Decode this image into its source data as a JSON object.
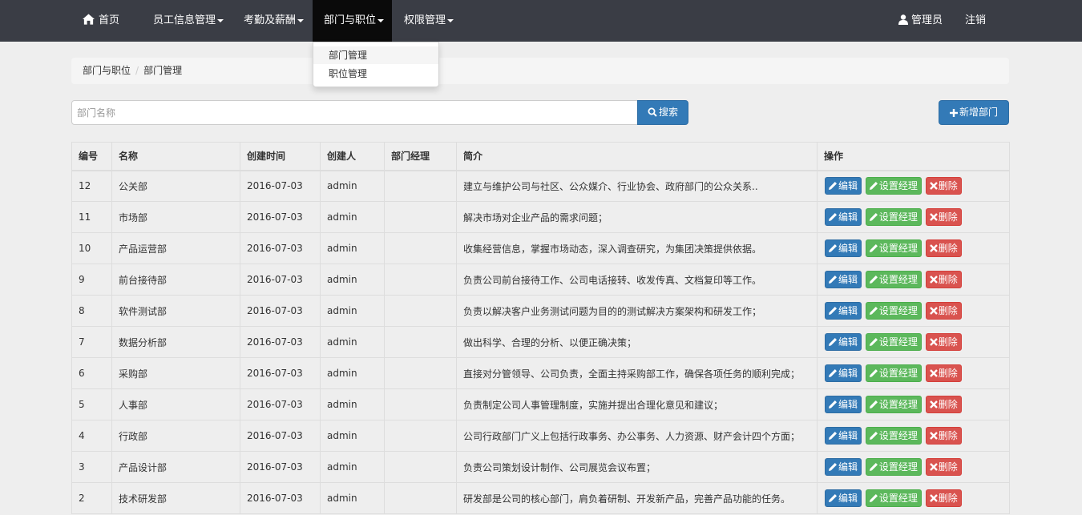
{
  "navbar": {
    "home": "首页",
    "menus": [
      "员工信息管理",
      "考勤及薪酬",
      "部门与职位",
      "权限管理"
    ],
    "user": "管理员",
    "logout": "注销"
  },
  "dropdown": {
    "items": [
      "部门管理",
      "职位管理"
    ]
  },
  "breadcrumb": {
    "parent": "部门与职位",
    "current": "部门管理"
  },
  "search": {
    "placeholder": "部门名称",
    "button": "搜索"
  },
  "add_button": "新增部门",
  "table": {
    "headers": [
      "编号",
      "名称",
      "创建时间",
      "创建人",
      "部门经理",
      "简介",
      "操作"
    ],
    "actions": {
      "edit": "编辑",
      "set_manager": "设置经理",
      "delete": "删除"
    },
    "rows": [
      {
        "id": "12",
        "name": "公关部",
        "created": "2016-07-03",
        "creator": "admin",
        "manager": "",
        "desc": "建立与维护公司与社区、公众媒介、行业协会、政府部门的公众关系.."
      },
      {
        "id": "11",
        "name": "市场部",
        "created": "2016-07-03",
        "creator": "admin",
        "manager": "",
        "desc": "解决市场对企业产品的需求问题；"
      },
      {
        "id": "10",
        "name": "产品运营部",
        "created": "2016-07-03",
        "creator": "admin",
        "manager": "",
        "desc": "收集经营信息，掌握市场动态，深入调查研究，为集团决策提供依据。"
      },
      {
        "id": "9",
        "name": "前台接待部",
        "created": "2016-07-03",
        "creator": "admin",
        "manager": "",
        "desc": "负责公司前台接待工作、公司电话接转、收发传真、文档复印等工作。"
      },
      {
        "id": "8",
        "name": "软件测试部",
        "created": "2016-07-03",
        "creator": "admin",
        "manager": "",
        "desc": "负责以解决客户业务测试问题为目的的测试解决方案架构和研发工作；"
      },
      {
        "id": "7",
        "name": "数据分析部",
        "created": "2016-07-03",
        "creator": "admin",
        "manager": "",
        "desc": "做出科学、合理的分析、以便正确决策；"
      },
      {
        "id": "6",
        "name": "采购部",
        "created": "2016-07-03",
        "creator": "admin",
        "manager": "",
        "desc": "直接对分管领导、公司负责，全面主持采购部工作，确保各项任务的顺利完成；"
      },
      {
        "id": "5",
        "name": "人事部",
        "created": "2016-07-03",
        "creator": "admin",
        "manager": "",
        "desc": "负责制定公司人事管理制度，实施并提出合理化意见和建议；"
      },
      {
        "id": "4",
        "name": "行政部",
        "created": "2016-07-03",
        "creator": "admin",
        "manager": "",
        "desc": "公司行政部门广义上包括行政事务、办公事务、人力资源、财产会计四个方面；"
      },
      {
        "id": "3",
        "name": "产品设计部",
        "created": "2016-07-03",
        "creator": "admin",
        "manager": "",
        "desc": "负责公司策划设计制作、公司展览会议布置；"
      },
      {
        "id": "2",
        "name": "技术研发部",
        "created": "2016-07-03",
        "creator": "admin",
        "manager": "",
        "desc": "研发部是公司的核心部门，肩负着研制、开发新产品，完善产品功能的任务。"
      }
    ]
  },
  "colors": {
    "navbar": "#3a3d45",
    "active_nav": "#0a0a0a",
    "primary": "#337ab7",
    "success": "#5cb85c",
    "danger": "#d9534f"
  }
}
